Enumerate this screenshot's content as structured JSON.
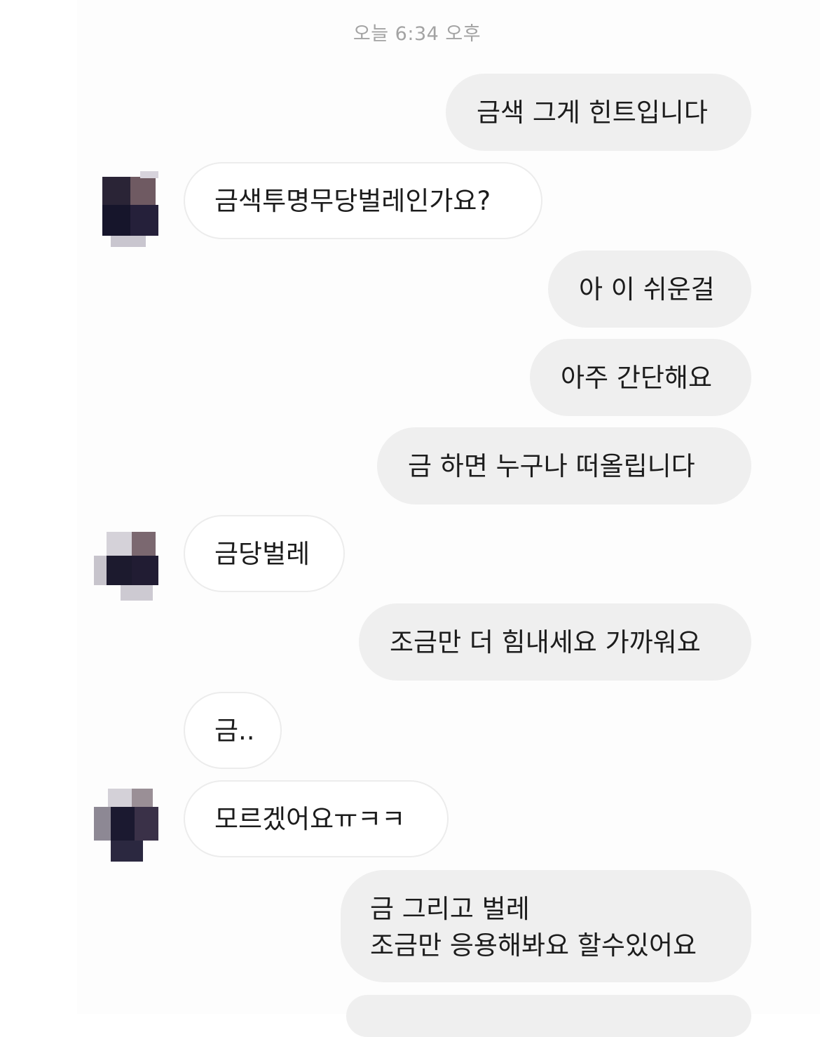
{
  "timestamp": "오늘 6:34 오후",
  "messages": {
    "m1": "금색 그게 힌트입니다",
    "m2": "금색투명무당벌레인가요?",
    "m3": "아 이 쉬운걸",
    "m4": "아주 간단해요",
    "m5": "금  하면 누구나 떠올립니다",
    "m6": "금당벌레",
    "m7": "조금만 더 힘내세요 가까워요",
    "m8": "금..",
    "m9": "모르겠어요ㅠㅋㅋ",
    "m10_line1": "금 그리고 벌레",
    "m10_line2": "조금만 응용해봐요 할수있어요"
  },
  "colors": {
    "outgoing_bubble": "#efefef",
    "incoming_bubble": "#ffffff",
    "timestamp_text": "#a3a3a3"
  }
}
